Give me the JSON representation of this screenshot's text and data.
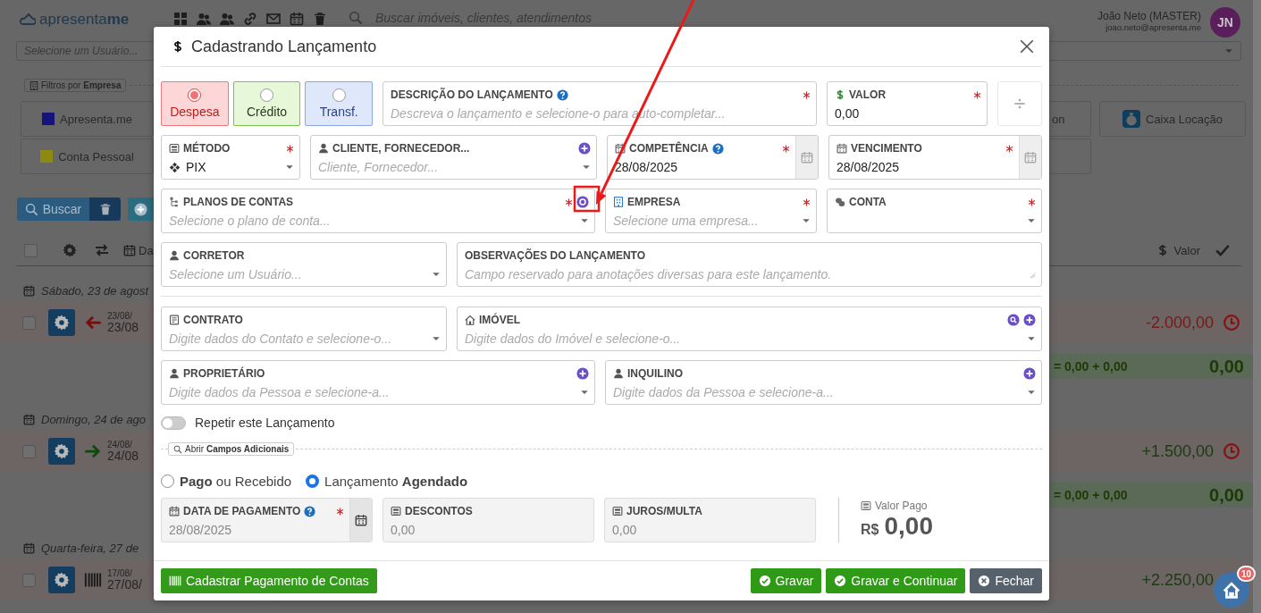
{
  "header": {
    "logo": "apresenta**me**",
    "search_placeholder": "Buscar imóveis, clientes, atendimentos",
    "user_name": "João Neto (MASTER)",
    "user_email": "joao.neto@apresenta.me",
    "avatar_initials": "JN"
  },
  "filters": {
    "user_placeholder": "Selecione um Usuário...",
    "company_filter_label": "Filtros por **Empresa**",
    "companies_left": [
      {
        "name": "Apresenta.me",
        "color": "#14147a"
      },
      {
        "name": "Conta Pessoal",
        "color": "#8c8a10"
      }
    ],
    "companies_right": [
      "on",
      "Caixa Locação"
    ],
    "search_button": "Buscar"
  },
  "list": {
    "select_all_checked": false,
    "header_date_fragment": "Da",
    "value_heading": "Valor",
    "groups": [
      {
        "date": "Sábado, 23 de agost",
        "entries": [
          {
            "checked": false,
            "kind": "debit",
            "date_small": "23/08/",
            "date": "23/08",
            "amount": "-2.000,00",
            "scheduled": true
          }
        ],
        "summary": {
          "formula": "= 0,00 + 0,00",
          "total": "0,00"
        }
      },
      {
        "date": "Domingo, 24 de ago",
        "entries": [
          {
            "checked": false,
            "kind": "credit",
            "date_small": "24/08/",
            "date": "24/08",
            "amount": "+1.500,00",
            "scheduled": true
          }
        ],
        "summary": {
          "formula": "= 0,00 + 0,00",
          "total": "0,00"
        }
      },
      {
        "date": "Quarta-feira, 27 de",
        "entries": [
          {
            "checked": false,
            "kind": "bill",
            "date_small": "17/08/",
            "date": "27/08/",
            "amount": "+2.250,00",
            "scheduled": false
          }
        ]
      }
    ]
  },
  "modal": {
    "title": "Cadastrando Lançamento",
    "types": [
      {
        "label": "Despesa",
        "kind": "expense",
        "selected": true
      },
      {
        "label": "Crédito",
        "kind": "credit",
        "selected": false
      },
      {
        "label": "Transf.",
        "kind": "transfer",
        "selected": false
      }
    ],
    "form_rows": [
      [
        {
          "kind": "text",
          "label": "DESCRIÇÃO DO LANÇAMENTO",
          "help": true,
          "required": true,
          "add": false,
          "search": false,
          "settings": false,
          "placeholder": "Descreva o lançamento e selecione-o para auto-completar..."
        },
        {
          "kind": "text",
          "label": "VALOR",
          "help": false,
          "required": true,
          "add": false,
          "search": false,
          "settings": false,
          "value": "0,00"
        }
      ],
      [
        {
          "kind": "select",
          "label": "MÉTODO",
          "help": false,
          "required": true,
          "add": false,
          "search": false,
          "settings": false,
          "value": "PIX"
        },
        {
          "kind": "select",
          "label": "CLIENTE, FORNECEDOR...",
          "help": false,
          "required": false,
          "add": true,
          "search": false,
          "settings": false,
          "placeholder": "Cliente, Fornecedor..."
        },
        {
          "kind": "date",
          "label": "COMPETÊNCIA",
          "help": true,
          "required": true,
          "add": false,
          "search": false,
          "settings": false,
          "value": "28/08/2025"
        },
        {
          "kind": "date",
          "label": "VENCIMENTO",
          "help": false,
          "required": true,
          "add": false,
          "search": false,
          "settings": false,
          "value": "28/08/2025"
        }
      ],
      [
        {
          "kind": "select",
          "label": "PLANOS DE CONTAS",
          "help": false,
          "required": true,
          "add": false,
          "search": false,
          "settings": true,
          "placeholder": "Selecione o plano de conta..."
        },
        {
          "kind": "select",
          "label": "EMPRESA",
          "help": false,
          "required": true,
          "add": false,
          "search": false,
          "settings": false,
          "placeholder": "Selecione uma empresa..."
        },
        {
          "kind": "select",
          "label": "CONTA",
          "help": false,
          "required": true,
          "add": false,
          "search": false,
          "settings": false
        }
      ],
      [
        {
          "kind": "select",
          "label": "CORRETOR",
          "help": false,
          "required": false,
          "add": false,
          "search": false,
          "settings": false,
          "placeholder": "Selecione um Usuário..."
        },
        {
          "kind": "textarea",
          "label": "OBSERVAÇÕES DO LANÇAMENTO",
          "help": false,
          "required": false,
          "add": false,
          "search": false,
          "settings": false,
          "placeholder": "Campo reservado para anotações diversas para este lançamento."
        }
      ],
      [
        {
          "kind": "select",
          "label": "CONTRATO",
          "help": false,
          "required": false,
          "add": false,
          "search": false,
          "settings": false,
          "placeholder": "Digite dados do Contato e selecione-o..."
        },
        {
          "kind": "select",
          "label": "IMÓVEL",
          "help": false,
          "required": false,
          "add": true,
          "search": true,
          "settings": false,
          "placeholder": "Digite dados do Imóvel e selecione-o..."
        }
      ],
      [
        {
          "kind": "select",
          "label": "PROPRIETÁRIO",
          "help": false,
          "required": false,
          "add": true,
          "search": false,
          "settings": false,
          "placeholder": "Digite dados da Pessoa e selecione-a..."
        },
        {
          "kind": "select",
          "label": "INQUILINO",
          "help": false,
          "required": false,
          "add": true,
          "search": false,
          "settings": false,
          "placeholder": "Digite dados da Pessoa e selecione-a..."
        }
      ]
    ],
    "repeat": {
      "label": "Repetir este Lançamento",
      "on": false
    },
    "extra_fields_button": "Abrir **Campos Adicionais**",
    "status_options": [
      {
        "label": "**Pago** ou Recebido",
        "selected": false
      },
      {
        "label": "Lançamento **Agendado**",
        "selected": true
      }
    ],
    "payment_fields": [
      {
        "kind": "date",
        "label": "DATA DE PAGAMENTO",
        "help": true,
        "required": true,
        "disabled": true,
        "value": "28/08/2025"
      },
      {
        "kind": "text",
        "label": "DESCONTOS",
        "help": false,
        "required": false,
        "disabled": true,
        "value": "0,00"
      },
      {
        "kind": "text",
        "label": "JUROS/MULTA",
        "help": false,
        "required": false,
        "disabled": true,
        "value": "0,00"
      }
    ],
    "valor_pago": {
      "label": "Valor Pago",
      "currency": "R$",
      "amount": "0,00"
    },
    "footer_buttons": [
      {
        "label": "Cadastrar Pagamento de Contas",
        "kind": "bill"
      },
      {
        "label": "Gravar",
        "kind": "save"
      },
      {
        "label": "Gravar e Continuar",
        "kind": "save"
      },
      {
        "label": "Fechar",
        "kind": "close"
      }
    ]
  },
  "fab": {
    "badge": "10"
  }
}
